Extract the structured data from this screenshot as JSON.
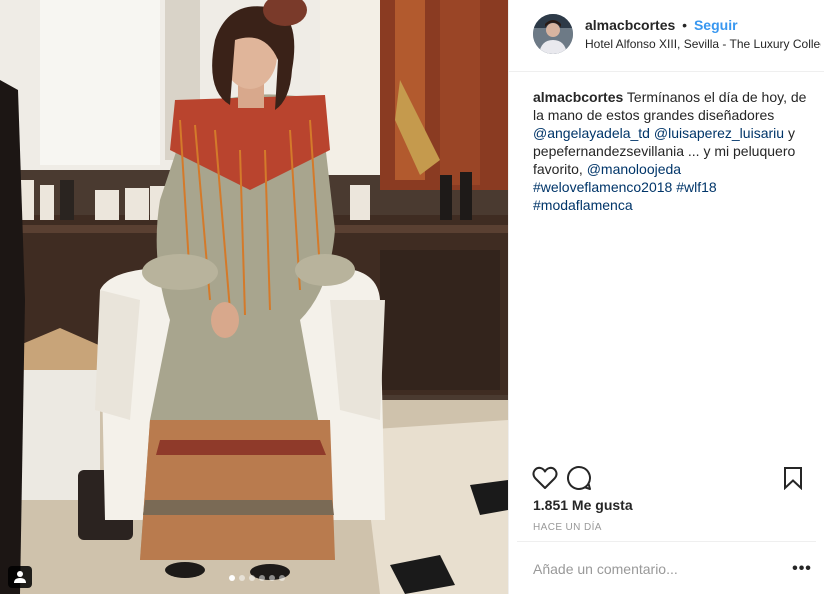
{
  "post": {
    "username": "almacbcortes",
    "separator": "•",
    "follow_label": "Seguir",
    "location": "Hotel Alfonso XIII, Sevilla - The Luxury Collection",
    "caption": {
      "user": "almacbcortes",
      "text_1": "Termínanos el día de hoy, de la mano de estos grandes diseñadores",
      "mention_1": "@angelayadela_td",
      "mention_2": "@luisaperez_luisariu",
      "text_2": "y",
      "text_3": "pepefernandezsevillania ... y mi peluquero favorito,",
      "mention_3": "@manoloojeda",
      "hashtag_1": "#weloveflamenco2018",
      "hashtag_2": "#wlf18",
      "hashtag_3": "#modaflamenca"
    },
    "likes": "1.851 Me gusta",
    "timestamp": "HACE UN DÍA",
    "comment_placeholder": "Añade un comentario...",
    "more_label": "•••",
    "carousel": {
      "count": 6,
      "active_index": 0
    }
  },
  "icons": {
    "like": "heart-icon",
    "comment": "comment-bubble-icon",
    "save": "bookmark-icon",
    "tags": "user-tag-icon"
  }
}
